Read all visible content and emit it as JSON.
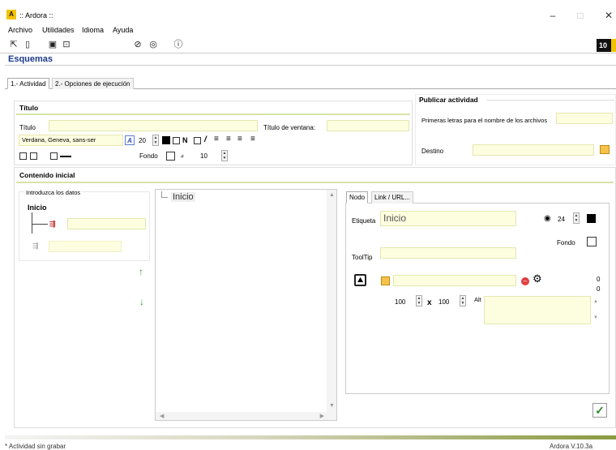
{
  "window": {
    "title": ":: Ardora ::",
    "minimize": "–",
    "maximize": "□",
    "close": "✕"
  },
  "menu": [
    "Archivo",
    "Utilidades",
    "Idioma",
    "Ayuda"
  ],
  "brand": {
    "text": "10"
  },
  "heading": "Esquemas",
  "tabs": [
    "1.- Actividad",
    "2.- Opciones de ejecución"
  ],
  "titulo_section": {
    "title": "Título",
    "titulo_label": "Título",
    "titulo_value": "",
    "ventana_label": "Título de ventana:",
    "ventana_value": "",
    "font_value": "Verdana, Geneva, sans-ser",
    "font_size": "20",
    "bold_label": "N",
    "italic_label": "/",
    "fondo_label": "Fondo",
    "border_size": "10"
  },
  "publicar": {
    "title": "Publicar actividad",
    "primeras_label": "Primeras letras para el nombre de los archivos",
    "primeras_value": "",
    "destino_label": "Destino",
    "destino_value": ""
  },
  "contenido": {
    "title": "Contenido inicial",
    "intro_label": "Introduzca los datos",
    "root_label": "Inicio",
    "child_value": "",
    "sibling_value": ""
  },
  "tree": {
    "root": "Inicio"
  },
  "node_panel": {
    "tabs": [
      "Nodo",
      "Link / URL..."
    ],
    "etiqueta_label": "Etiqueta",
    "etiqueta_value": "Inicio",
    "font_size": "24",
    "fondo_label": "Fondo",
    "tooltip_label": "ToolTip",
    "tooltip_value": "",
    "image_value": "",
    "count_a": "0",
    "count_b": "0",
    "width": "100",
    "times": "x",
    "height": "100",
    "alt_label": "Alt",
    "alt_value": ""
  },
  "status": {
    "left": "* Actividad sin grabar",
    "right": "Ardora V.10.3a"
  },
  "colors": {
    "accent": "#1a3a8a",
    "input_bg": "#fdfde0",
    "section_line": "#d7e4a6",
    "ok": "#2e8b2e"
  }
}
